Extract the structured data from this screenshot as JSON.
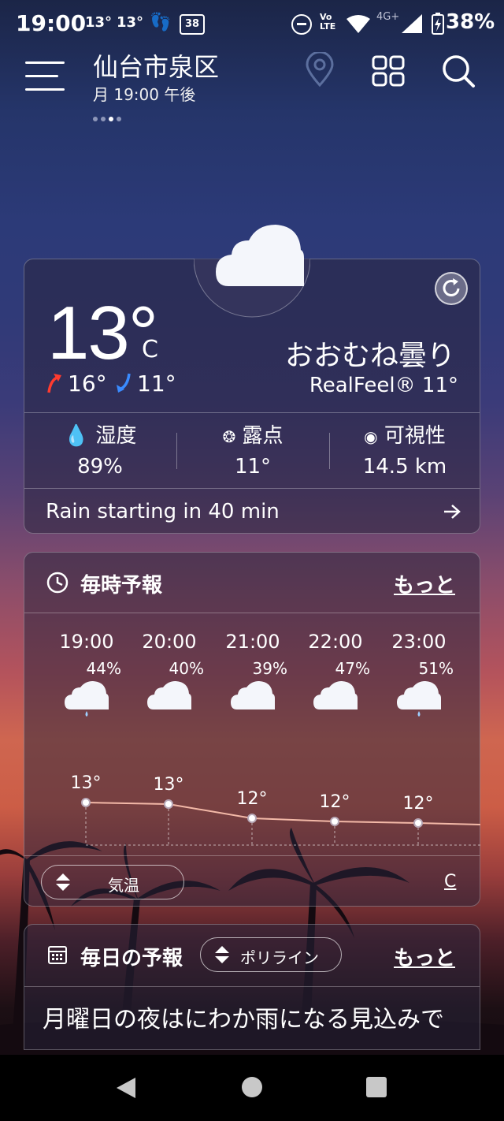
{
  "status_bar": {
    "time": "19:00",
    "temp_a": "13°",
    "temp_b": "13°",
    "calendar_num": "38",
    "network": "4G+",
    "battery": "38%",
    "volte": "Vo LTE"
  },
  "header": {
    "city": "仙台市泉区",
    "datetime": "月 19:00 午後",
    "page_dots": 4,
    "active_dot": 2
  },
  "current": {
    "temperature": "13°",
    "unit": "C",
    "high": "16°",
    "low": "11°",
    "condition": "おおむね曇り",
    "realfeel": "RealFeel® 11°",
    "humidity_label": "湿度",
    "humidity_value": "89%",
    "dewpoint_label": "露点",
    "dewpoint_value": "11°",
    "visibility_label": "可視性",
    "visibility_value": "14.5 km",
    "rain_notice": "Rain starting in 40 min"
  },
  "hourly": {
    "title": "毎時予報",
    "more": "もっと",
    "items": [
      {
        "time": "19:00",
        "pct": "44%",
        "temp": "13°",
        "icon": "cloud-rain-icon"
      },
      {
        "time": "20:00",
        "pct": "40%",
        "temp": "13°",
        "icon": "cloud-icon"
      },
      {
        "time": "21:00",
        "pct": "39%",
        "temp": "12°",
        "icon": "cloud-icon"
      },
      {
        "time": "22:00",
        "pct": "47%",
        "temp": "12°",
        "icon": "cloud-icon"
      },
      {
        "time": "23:00",
        "pct": "51%",
        "temp": "12°",
        "icon": "cloud-rain-icon"
      }
    ],
    "metric_selector": "気温",
    "unit_toggle": "C"
  },
  "daily": {
    "title": "毎日の予報",
    "style_selector": "ポリライン",
    "more": "もっと",
    "summary": "月曜日の夜はにわか雨になる見込みで"
  },
  "colors": {
    "high_arrow": "#ff3b2f",
    "low_arrow": "#3a8bff",
    "temp_line": "#f3b9a8"
  }
}
